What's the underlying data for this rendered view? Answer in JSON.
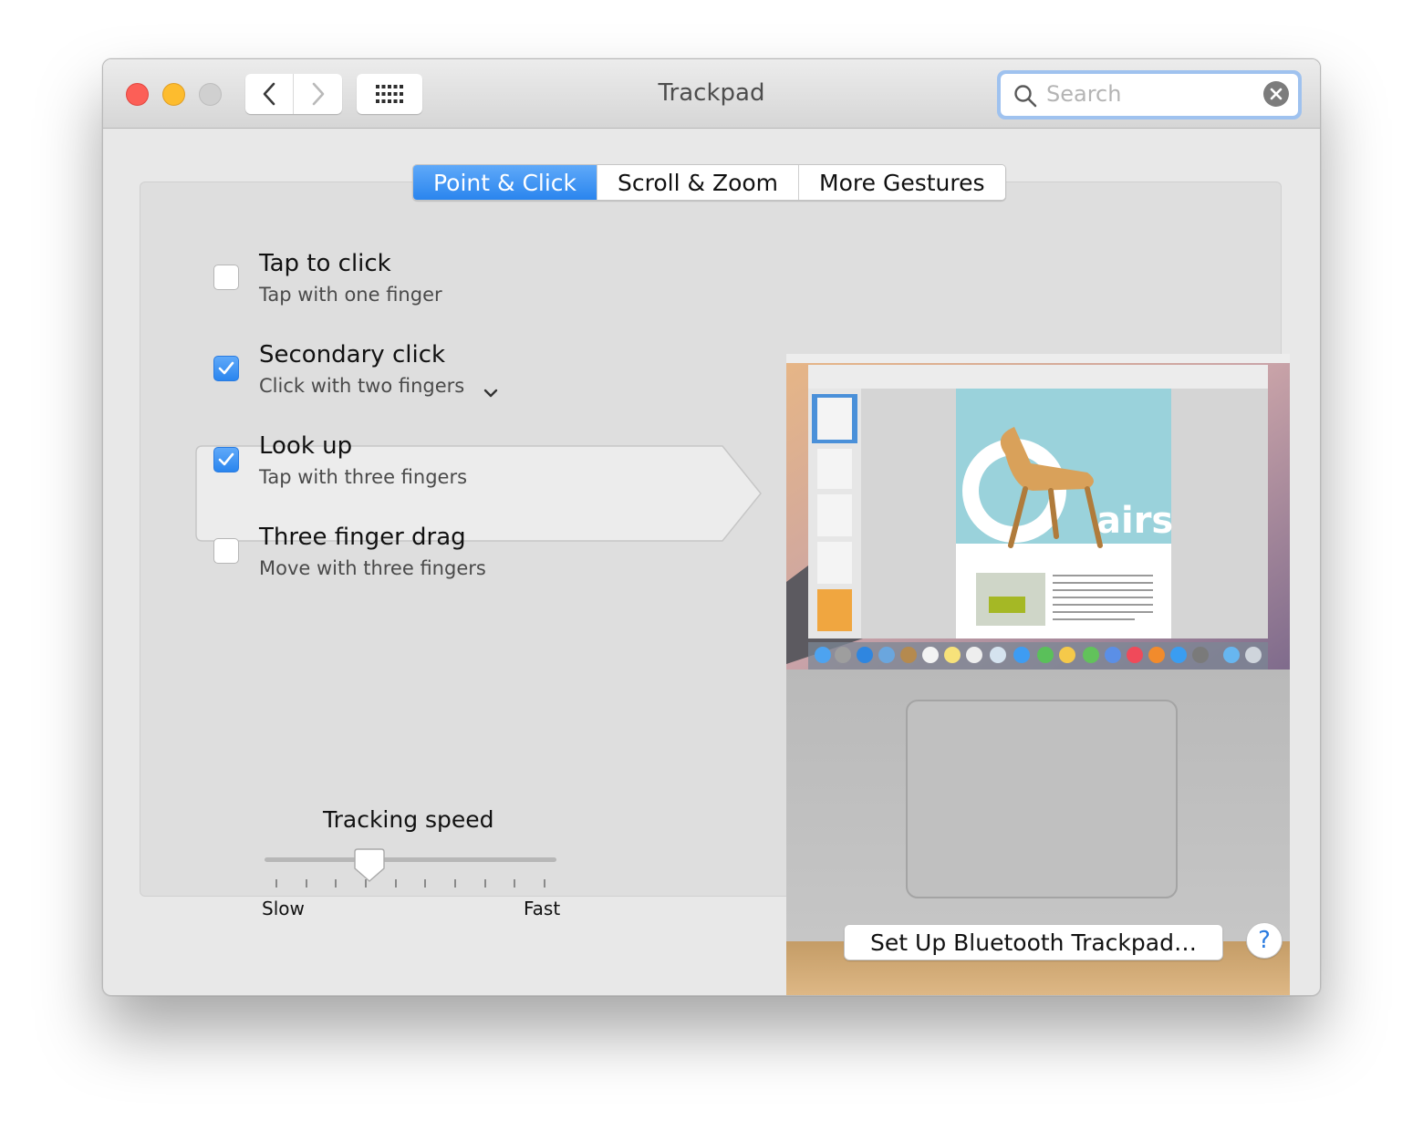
{
  "window": {
    "title": "Trackpad"
  },
  "search": {
    "placeholder": "Search",
    "value": ""
  },
  "tabs": [
    {
      "label": "Point & Click",
      "active": true
    },
    {
      "label": "Scroll & Zoom",
      "active": false
    },
    {
      "label": "More Gestures",
      "active": false
    }
  ],
  "options": [
    {
      "title": "Tap to click",
      "subtitle": "Tap with one finger",
      "checked": false
    },
    {
      "title": "Secondary click",
      "subtitle": "Click with two fingers",
      "checked": true,
      "has_dropdown": true
    },
    {
      "title": "Look up",
      "subtitle": "Tap with three fingers",
      "checked": true
    },
    {
      "title": "Three finger drag",
      "subtitle": "Move with three fingers",
      "checked": false
    }
  ],
  "tracking": {
    "label": "Tracking speed",
    "min_label": "Slow",
    "max_label": "Fast",
    "ticks": 10,
    "level": 0.35
  },
  "footer": {
    "bluetooth_button": "Set Up Bluetooth Trackpad…",
    "help_button": "?"
  },
  "icons": {
    "back": "chevron-left-icon",
    "forward": "chevron-right-icon",
    "grid": "grid-icon",
    "search": "search-icon",
    "clear": "clear-icon",
    "checkmark": "checkmark-icon",
    "dropdown": "chevron-down-icon"
  },
  "colors": {
    "accent": "#2a85ee",
    "close": "#fc5f57",
    "minimize": "#fdbc2e",
    "zoom": "#d0d0d0"
  }
}
